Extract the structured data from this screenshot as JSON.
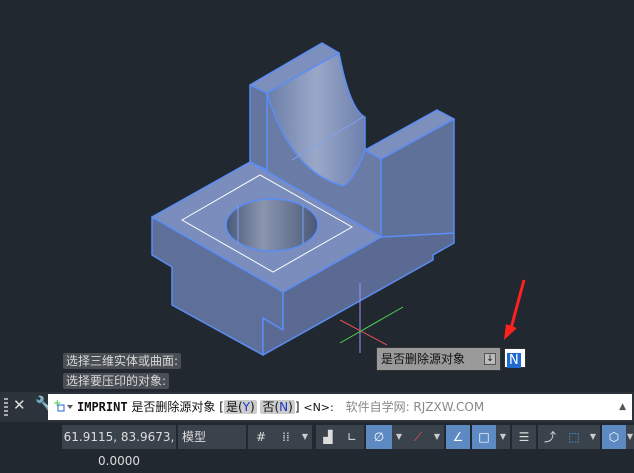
{
  "history": [
    "选择三维实体或曲面:",
    "选择要压印的对象:"
  ],
  "tooltip": {
    "label": "是否删除源对象",
    "input_value": "N"
  },
  "command": {
    "name": "IMPRINT",
    "prompt": "是否删除源对象",
    "bracket_open": "[",
    "opt_yes": "是(",
    "opt_yes_key": "Y",
    "opt_no": "否(",
    "opt_no_key": "N",
    "close": ")",
    "bracket_close": "]",
    "default": "<N>:",
    "placeholder": "软件自学网: RJZXW.COM"
  },
  "status": {
    "coords": "61.9115, 83.9673, 0.0000",
    "model": "模型"
  }
}
